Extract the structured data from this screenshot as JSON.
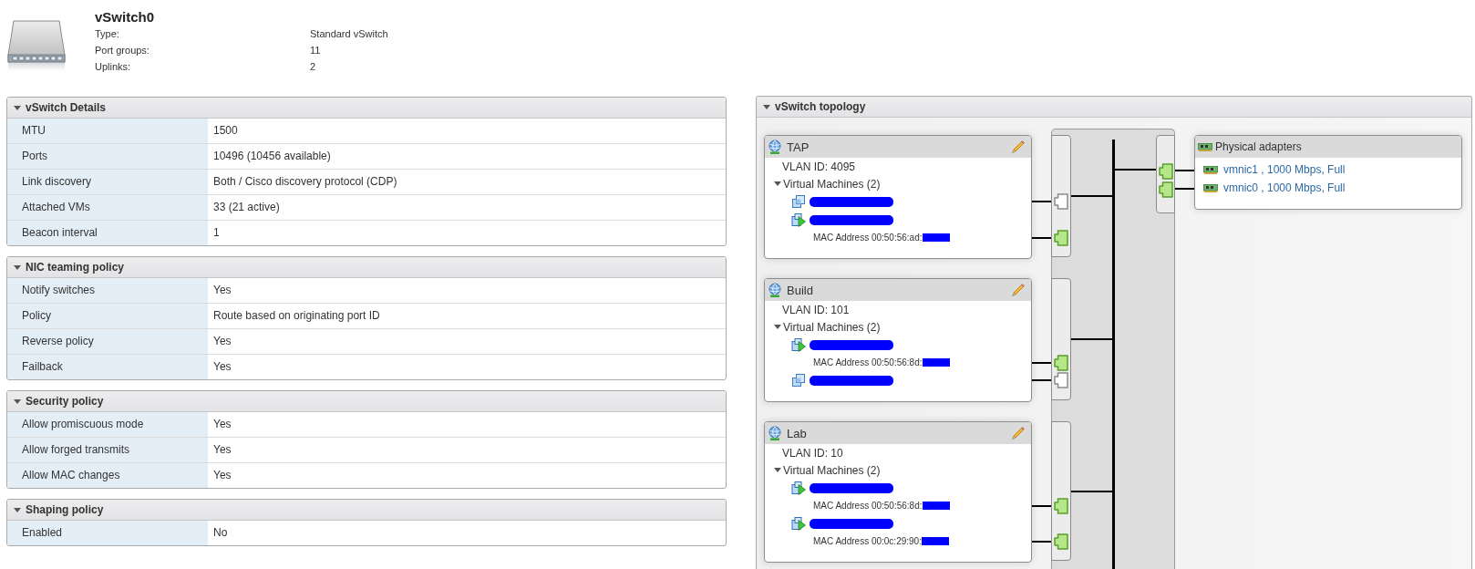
{
  "summary": {
    "title": "vSwitch0",
    "properties": [
      {
        "label": "Type:",
        "value": "Standard vSwitch"
      },
      {
        "label": "Port groups:",
        "value": "11"
      },
      {
        "label": "Uplinks:",
        "value": "2"
      }
    ]
  },
  "sections": [
    {
      "title": "vSwitch Details",
      "expanded": true,
      "rows": [
        {
          "label": "MTU",
          "value": "1500"
        },
        {
          "label": "Ports",
          "value": "10496 (10456 available)"
        },
        {
          "label": "Link discovery",
          "value": "Both / Cisco discovery protocol (CDP)"
        },
        {
          "label": "Attached VMs",
          "value": "33 (21 active)"
        },
        {
          "label": "Beacon interval",
          "value": "1"
        }
      ]
    },
    {
      "title": "NIC teaming policy",
      "expanded": true,
      "rows": [
        {
          "label": "Notify switches",
          "value": "Yes"
        },
        {
          "label": "Policy",
          "value": "Route based on originating port ID"
        },
        {
          "label": "Reverse policy",
          "value": "Yes"
        },
        {
          "label": "Failback",
          "value": "Yes"
        }
      ]
    },
    {
      "title": "Security policy",
      "expanded": true,
      "rows": [
        {
          "label": "Allow promiscuous mode",
          "value": "Yes"
        },
        {
          "label": "Allow forged transmits",
          "value": "Yes"
        },
        {
          "label": "Allow MAC changes",
          "value": "Yes"
        }
      ]
    },
    {
      "title": "Shaping policy",
      "expanded": true,
      "rows": [
        {
          "label": "Enabled",
          "value": "No"
        }
      ]
    }
  ],
  "topology": {
    "title": "vSwitch topology",
    "expanded": true,
    "port_groups": [
      {
        "name": "TAP",
        "vlan": "VLAN ID: 4095",
        "vms_label": "Virtual Machines (2)",
        "vms_expanded": true,
        "vms": [
          {
            "powered_on": false
          },
          {
            "powered_on": true,
            "mac": "MAC Address 00:50:56:ad:"
          }
        ]
      },
      {
        "name": "Build",
        "vlan": "VLAN ID: 101",
        "vms_label": "Virtual Machines (2)",
        "vms_expanded": true,
        "vms": [
          {
            "powered_on": true,
            "mac": "MAC Address 00:50:56:8d:"
          },
          {
            "powered_on": false
          }
        ]
      },
      {
        "name": "Lab",
        "vlan": "VLAN ID: 10",
        "vms_label": "Virtual Machines (2)",
        "vms_expanded": true,
        "vms": [
          {
            "powered_on": true,
            "mac": "MAC Address 00:50:56:8d:"
          },
          {
            "powered_on": true,
            "mac": "MAC Address 00:0c:29:90:"
          }
        ]
      }
    ],
    "physical_adapters": {
      "title": "Physical adapters",
      "adapters": [
        {
          "label": "vmnic1 , 1000 Mbps, Full",
          "link_up": true
        },
        {
          "label": "vmnic0 , 1000 Mbps, Full",
          "link_up": true
        }
      ]
    }
  }
}
